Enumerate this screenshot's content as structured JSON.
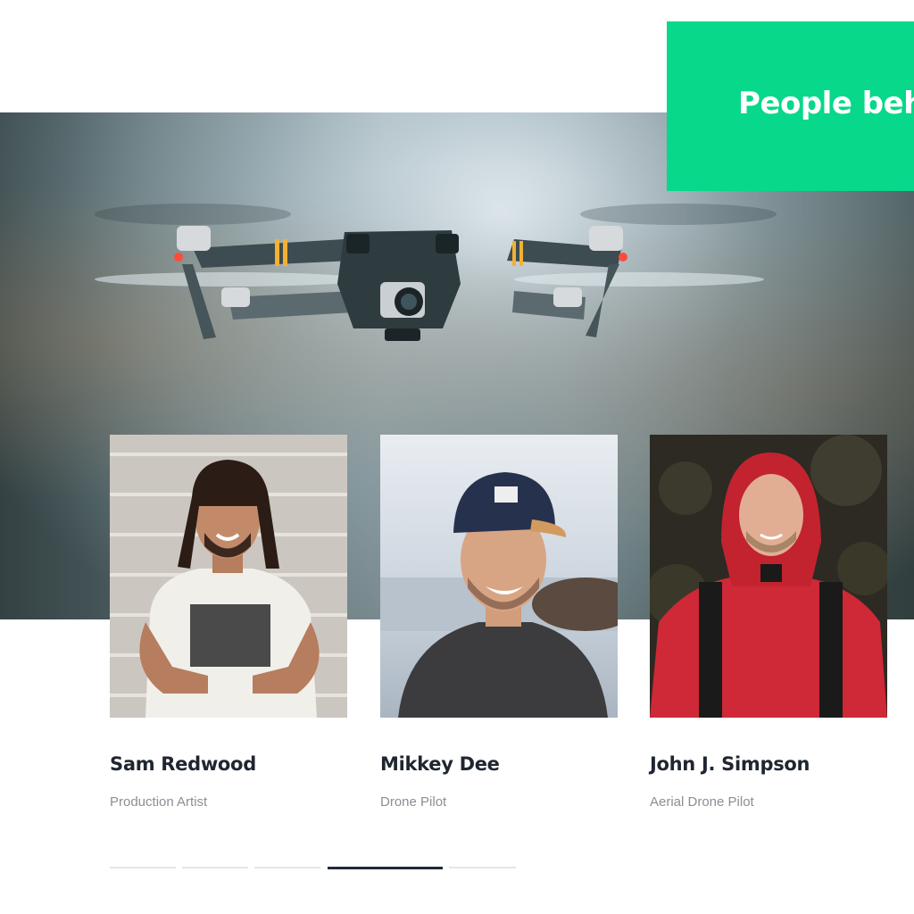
{
  "callout": {
    "title": "People behi"
  },
  "team": [
    {
      "name": "Sam Redwood",
      "role": "Production Artist"
    },
    {
      "name": "Mikkey Dee",
      "role": "Drone Pilot"
    },
    {
      "name": "John J. Simpson",
      "role": "Aerial Drone Pilot"
    }
  ],
  "pager": {
    "count": 5,
    "active_index": 3
  },
  "colors": {
    "accent": "#07d88a",
    "heading": "#1f2630",
    "muted": "#8a8f94",
    "pager_active": "#1f2a3a",
    "pager_inactive": "#e3e5e8"
  }
}
